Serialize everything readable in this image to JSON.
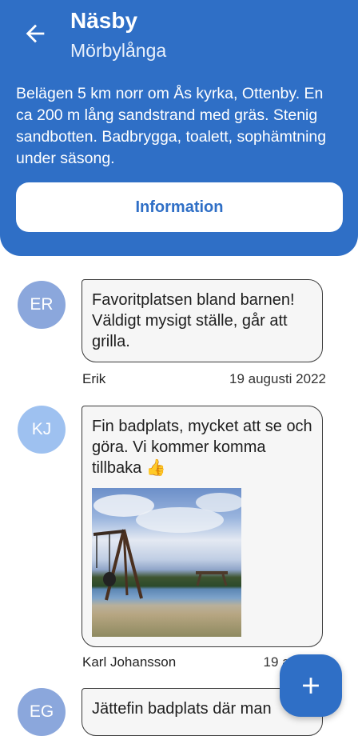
{
  "header": {
    "title": "Näsby",
    "subtitle": "Mörbylånga",
    "description": "Belägen 5 km norr om Ås kyrka, Ottenby. En ca 200 m lång sandstrand med gräs. Stenig sandbotten. Badbrygga, toalett, sophämtning under säsong.",
    "info_button": "Information",
    "back_icon": "arrow-left-icon"
  },
  "comments": [
    {
      "initials": "ER",
      "avatar_color": "#8ba7dc",
      "text": "Favoritplatsen bland barnen! Väldigt mysigt ställe, går att grilla.",
      "author": "Erik",
      "date": "19 augusti 2022"
    },
    {
      "initials": "KJ",
      "avatar_color": "#9ec1f0",
      "text": "Fin badplats, mycket att se och göra. Vi kommer komma tillbaka 👍",
      "author": "Karl Johansson",
      "date": "19 augusti",
      "has_photo": true
    },
    {
      "initials": "EG",
      "avatar_color": "#8ba7dc",
      "text": "Jättefin badplats där man"
    }
  ],
  "fab": {
    "icon": "plus-icon"
  },
  "colors": {
    "primary": "#2f6fc6",
    "bubble": "#f6f6f6"
  }
}
